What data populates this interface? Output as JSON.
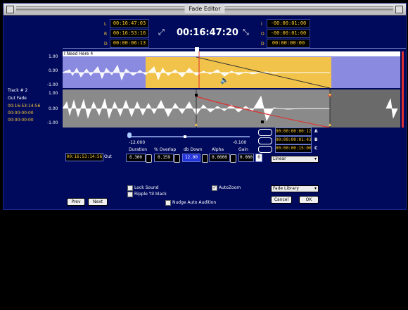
{
  "window": {
    "title": "Fade Editor"
  },
  "counters_left": [
    {
      "key": "L",
      "value": "00:16:47:03"
    },
    {
      "key": "R",
      "value": "00:16:53:16"
    },
    {
      "key": "D",
      "value": "00:00:06:13"
    }
  ],
  "counters_right": [
    {
      "key": "I",
      "value": "-00:00:01:00"
    },
    {
      "key": "O",
      "value": "-00:00:01:00"
    },
    {
      "key": "D",
      "value": "00:00:00:00"
    }
  ],
  "main_time": "00:16:47:20",
  "clip_name": "I Need Here 4",
  "track": {
    "label": "Track # 2",
    "mode": "Out Fade",
    "times": [
      "00:16:53:14:56",
      "00:00:00:00",
      "00:00:00:00"
    ]
  },
  "scale_top": [
    "1.00",
    "0.00",
    "-1.00"
  ],
  "scale_bottom": [
    "1.00",
    "0.00",
    "-1.00"
  ],
  "slider": {
    "left": "-12.000",
    "right": "-0.100"
  },
  "left_time": "00:16:53:14:56",
  "out_label": "Out",
  "params": {
    "headers": [
      "Duration",
      "% Overlap",
      "db Down",
      "Alpha",
      "Gain"
    ],
    "values": [
      "6.300",
      "0.159",
      "12.00",
      "0.0000",
      "0.000"
    ],
    "gain_flag": "0"
  },
  "abc": [
    {
      "time": "00:00:00:00:12",
      "letter": "A"
    },
    {
      "time": "00:00:00:01:43",
      "letter": "B"
    },
    {
      "time": "00:00:00:15:00",
      "letter": "C"
    }
  ],
  "curve_select": "Linear",
  "fade_library": "Fade Library",
  "checks": {
    "lock_sound": {
      "label": "Lock Sound",
      "checked": false
    },
    "ripple": {
      "label": "Ripple 'til black",
      "checked": false
    },
    "autozoom": {
      "label": "AutoZoom",
      "checked": true
    },
    "nudge": {
      "label": "Nudge Auto Audition",
      "checked": false
    }
  },
  "buttons": {
    "prev": "Prev",
    "next": "Next",
    "cancel": "Cancel",
    "ok": "OK"
  },
  "colors": {
    "bg": "#000a5c",
    "selection": "#f2c34a",
    "fade_region": "#8a8a8a",
    "outside": "#8a8ae0",
    "curve": "#e03030"
  }
}
